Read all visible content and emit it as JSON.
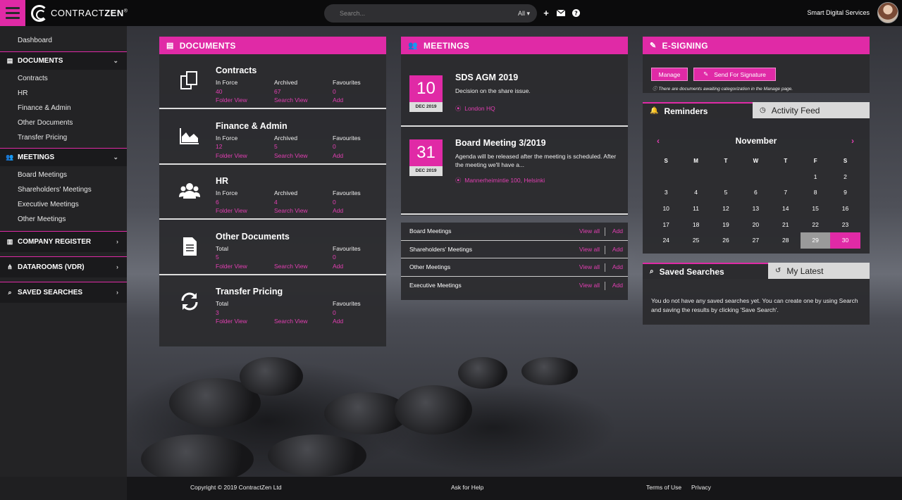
{
  "topbar": {
    "logo_text": "CONTRACT",
    "logo_bold": "ZEN",
    "logo_reg": "®",
    "search_placeholder": "Search...",
    "search_scope": "All ▾",
    "user_name": "Smart Digital Services"
  },
  "sidebar": {
    "dashboard": "Dashboard",
    "documents": {
      "label": "DOCUMENTS",
      "items": [
        "Contracts",
        "HR",
        "Finance & Admin",
        "Other Documents",
        "Transfer Pricing"
      ]
    },
    "meetings": {
      "label": "MEETINGS",
      "items": [
        "Board Meetings",
        "Shareholders' Meetings",
        "Executive Meetings",
        "Other Meetings"
      ]
    },
    "company_register": "COMPANY REGISTER",
    "datarooms": "DATAROOMS (VDR)",
    "saved_searches": "SAVED SEARCHES"
  },
  "documents": {
    "title": "DOCUMENTS",
    "rows": [
      {
        "title": "Contracts",
        "c1_label": "In Force",
        "c1_value": "40",
        "c1_link": "Folder View",
        "c2_label": "Archived",
        "c2_value": "67",
        "c2_link": "Search View",
        "c3_label": "Favourites",
        "c3_value": "0",
        "c3_link": "Add"
      },
      {
        "title": "Finance & Admin",
        "c1_label": "In Force",
        "c1_value": "12",
        "c1_link": "Folder View",
        "c2_label": "Archived",
        "c2_value": "5",
        "c2_link": "Search View",
        "c3_label": "Favourites",
        "c3_value": "0",
        "c3_link": "Add"
      },
      {
        "title": "HR",
        "c1_label": "In Force",
        "c1_value": "6",
        "c1_link": "Folder View",
        "c2_label": "Archived",
        "c2_value": "4",
        "c2_link": "Search View",
        "c3_label": "Favourites",
        "c3_value": "0",
        "c3_link": "Add"
      },
      {
        "title": "Other Documents",
        "c1_label": "Total",
        "c1_value": "5",
        "c1_link": "Folder View",
        "c2_label": "",
        "c2_value": "",
        "c2_link": "Search View",
        "c3_label": "Favourites",
        "c3_value": "0",
        "c3_link": "Add"
      },
      {
        "title": "Transfer Pricing",
        "c1_label": "Total",
        "c1_value": "3",
        "c1_link": "Folder View",
        "c2_label": "",
        "c2_value": "",
        "c2_link": "Search View",
        "c3_label": "Favourites",
        "c3_value": "0",
        "c3_link": "Add"
      }
    ]
  },
  "meetings": {
    "title": "MEETINGS",
    "items": [
      {
        "day": "10",
        "month": "DEC 2019",
        "title": "SDS AGM 2019",
        "desc": "Decision on the share issue.",
        "location": "London HQ"
      },
      {
        "day": "31",
        "month": "DEC 2019",
        "title": "Board Meeting 3/2019",
        "desc": "Agenda will be released after the meeting is scheduled. After the meeting we'll have a...",
        "location": "Mannerheimintie 100, Helsinki"
      }
    ],
    "links": [
      {
        "label": "Board Meetings",
        "view": "View all",
        "add": "Add"
      },
      {
        "label": "Shareholders' Meetings",
        "view": "View all",
        "add": "Add"
      },
      {
        "label": "Other Meetings",
        "view": "View all",
        "add": "Add"
      },
      {
        "label": "Executive Meetings",
        "view": "View all",
        "add": "Add"
      }
    ]
  },
  "esigning": {
    "title": "E-SIGNING",
    "manage": "Manage",
    "send": "Send For Signature",
    "note": "There are documents awaiting categorization in the Manage page."
  },
  "reminders": {
    "tab_active": "Reminders",
    "tab_inactive": "Activity Feed",
    "month": "November",
    "prev": "‹",
    "next": "›",
    "dow": [
      "S",
      "M",
      "T",
      "W",
      "T",
      "F",
      "S"
    ],
    "weeks": [
      [
        "",
        "",
        "",
        "",
        "",
        "1",
        "2"
      ],
      [
        "3",
        "4",
        "5",
        "6",
        "7",
        "8",
        "9"
      ],
      [
        "10",
        "11",
        "12",
        "13",
        "14",
        "15",
        "16"
      ],
      [
        "17",
        "18",
        "19",
        "20",
        "21",
        "22",
        "23"
      ],
      [
        "24",
        "25",
        "26",
        "27",
        "28",
        "29",
        "30"
      ]
    ]
  },
  "saved": {
    "tab_active": "Saved Searches",
    "tab_inactive": "My Latest",
    "text": "You do not have any saved searches yet. You can create one by using Search and saving the results by clicking 'Save Search'."
  },
  "footer": {
    "copyright": "Copyright © 2019  ContractZen Ltd",
    "help": "Ask for Help",
    "terms": "Terms of Use",
    "privacy": "Privacy"
  },
  "colors": {
    "accent": "#e02aa6",
    "panel": "#2c2c2f",
    "topbar": "#0b0b0c"
  }
}
